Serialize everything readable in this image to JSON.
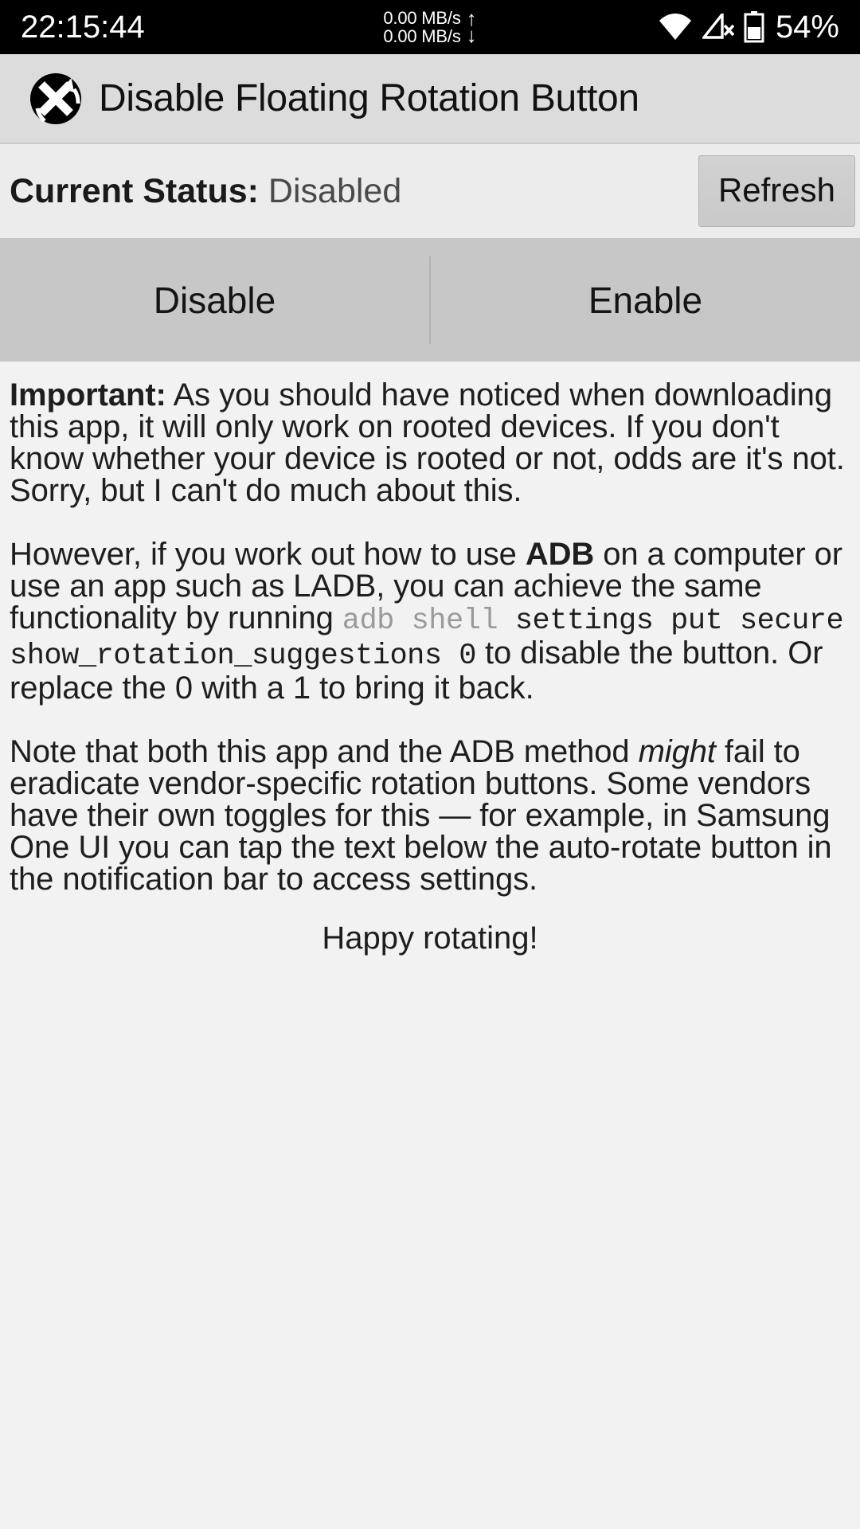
{
  "statusbar": {
    "clock": "22:15:44",
    "net_up": "0.00 MB/s",
    "net_down": "0.00 MB/s",
    "arrow_up": "↑",
    "arrow_down": "↓",
    "battery_percent": "54%",
    "icons": [
      "wifi-icon",
      "cellular-signal-off-icon",
      "battery-icon"
    ],
    "background_color": "#000000",
    "foreground_color": "#ffffff"
  },
  "appbar": {
    "title": "Disable Floating Rotation Button",
    "logo_name": "rotation-disabled-app-icon",
    "background_color": "#dcdcdc"
  },
  "status_row": {
    "label": "Current Status:",
    "value": "Disabled",
    "refresh_label": "Refresh"
  },
  "actions": {
    "disable_label": "Disable",
    "enable_label": "Enable"
  },
  "body": {
    "p1_lead": "Important:",
    "p1_text": " As you should have noticed when downloading this app, it will only work on rooted devices. If you don't know whether your device is rooted or not, odds are it's not. Sorry, but I can't do much about this.",
    "p2_part1": "However, if you work out how to use ",
    "p2_bold": "ADB",
    "p2_part2": " on a computer or use an app such as LADB, you can achieve the same functionality by running ",
    "p2_code_dim": "adb shell",
    "p2_code_space": " ",
    "p2_code": "settings put secure show_rotation_suggestions 0",
    "p2_part3": " to disable the button. Or replace the 0 with a 1 to bring it back.",
    "p3_part1": "Note that both this app and the ADB method ",
    "p3_italic": "might",
    "p3_part2": " fail to eradicate vendor-specific rotation buttons. Some vendors have their own toggles for this — for example, in Samsung One UI you can tap the text below the auto-rotate button in the notification bar to access settings.",
    "closing": "Happy rotating!"
  },
  "colors": {
    "page_bg": "#f2f2f2",
    "appbar_bg": "#dcdcdc",
    "status_bg": "#ececec",
    "action_bg": "#c7c7c7",
    "text": "#1e1e1e",
    "code_dim": "#9a9a9a"
  }
}
